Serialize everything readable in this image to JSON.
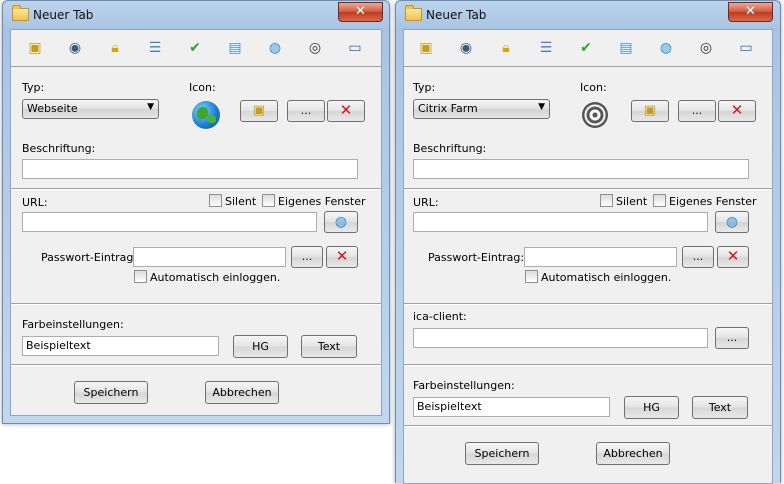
{
  "left": {
    "title": "Neuer Tab",
    "close": "✕",
    "type_label": "Typ:",
    "type_value": "Webseite",
    "icon_label": "Icon:",
    "browse": "...",
    "caption_label": "Beschriftung:",
    "caption_value": "",
    "url_label": "URL:",
    "silent_label": "Silent",
    "own_window_label": "Eigenes Fenster",
    "url_value": "",
    "password_label": "Passwort-Eintrag:",
    "password_value": "",
    "password_browse": "...",
    "auto_login_label": "Automatisch einloggen.",
    "color_label": "Farbeinstellungen:",
    "sample_text": "Beispieltext",
    "bg_button": "HG",
    "text_button": "Text",
    "save_button": "Speichern",
    "cancel_button": "Abbrechen"
  },
  "right": {
    "title": "Neuer Tab",
    "close": "✕",
    "type_label": "Typ:",
    "type_value": "Citrix Farm",
    "icon_label": "Icon:",
    "browse": "...",
    "caption_label": "Beschriftung:",
    "caption_value": "",
    "url_label": "URL:",
    "silent_label": "Silent",
    "own_window_label": "Eigenes Fenster",
    "url_value": "",
    "password_label": "Passwort-Eintrag:",
    "password_value": "",
    "password_browse": "...",
    "auto_login_label": "Automatisch einloggen.",
    "ica_label": "ica-client:",
    "ica_value": "",
    "ica_browse": "...",
    "color_label": "Farbeinstellungen:",
    "sample_text": "Beispieltext",
    "bg_button": "HG",
    "text_button": "Text",
    "save_button": "Speichern",
    "cancel_button": "Abbrechen"
  },
  "toolbar_icons": [
    "folder-add-icon",
    "disc-icon",
    "lock-icon",
    "list-icon",
    "checkmark-icon",
    "layers-icon",
    "globe-icon",
    "citrix-icon",
    "monitor-icon"
  ],
  "colors": {
    "title_bar": "#a9c4e3",
    "client_bg": "#f0f0f0",
    "delete_red": "#d0161c",
    "close_red": "#c03a1e"
  }
}
